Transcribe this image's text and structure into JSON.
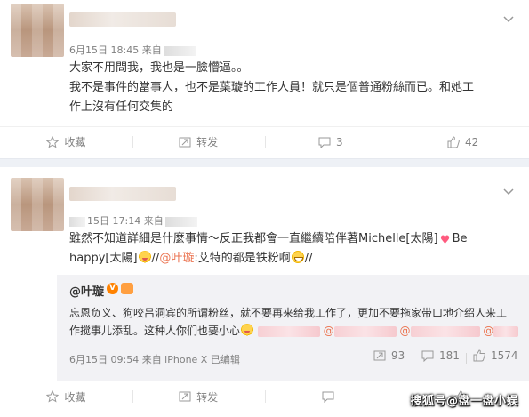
{
  "post1": {
    "meta": "6月15日 18:45 来自",
    "lines": [
      "大家不用問我，我也是一臉懵逼。。",
      "我不是事件的當事人，也不是葉璇的工作人員！就只是個普通粉絲而已。和她工",
      "作上沒有任何交集的"
    ],
    "actions": {
      "favorite": "收藏",
      "repost": "转发",
      "comments": "3",
      "likes": "42"
    }
  },
  "post2": {
    "meta": "15日 17:14 来自",
    "line1": "雖然不知道詳細是什麼事情～反正我都會一直繼續陪伴著Michelle[太陽]",
    "line1_end": "Be",
    "line2_a": "happy[太陽]",
    "line2_b": "//",
    "line2_mention": "@叶璇",
    "line2_c": ":艾特的都是铁粉啊",
    "line2_d": "//",
    "quote": {
      "name": "@叶璇",
      "badge": "V",
      "line1": "忘恩负义、狗咬吕洞宾的所谓粉丝，就不要再来给我工作了，更加不要拖家带口地介绍人来工",
      "line2_a": "作搅事儿添乱。这种人你们也要小心",
      "line2_at1": "@",
      "line2_at2": "@",
      "line2_at3": "@",
      "meta": "6月15日 09:54 来自 iPhone X  已编辑",
      "reposts": "93",
      "comments": "181",
      "likes": "1574"
    },
    "actions": {
      "favorite": "收藏",
      "repost": "转发",
      "comments": "",
      "likes": ""
    }
  },
  "watermark": "搜狐号@盘一盘小娱",
  "colors": {
    "accent": "#eb7350",
    "separator": "#eef1f6",
    "quote_bg": "#f2f2f5"
  }
}
